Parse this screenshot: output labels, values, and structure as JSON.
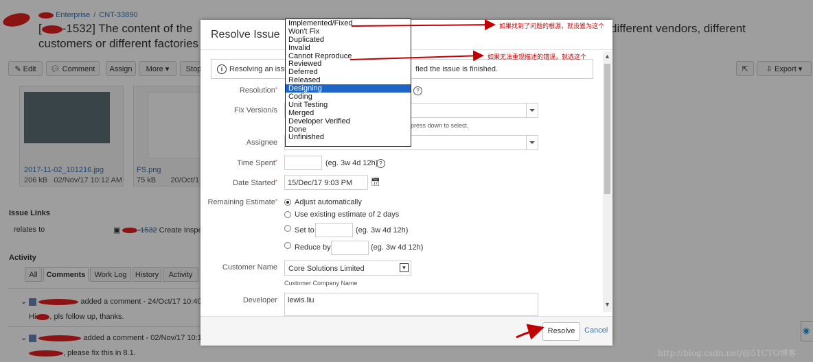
{
  "background": {
    "breadcrumb": {
      "project": "Enterprise",
      "issue_key": "CNT-33890"
    },
    "issue_title": {
      "left": "-1532] The content of the",
      "left_prefix": "[",
      "right": "different vendors, different",
      "line2": "customers or different factories"
    },
    "toolbar": {
      "edit": "Edit",
      "comment": "Comment",
      "assign": "Assign",
      "more": "More",
      "stop": "Stop",
      "export": "Export"
    },
    "attachments": [
      {
        "name": "2017-11-02_101216.jpg",
        "size": "206 kB",
        "date": "02/Nov/17 10:12 AM"
      },
      {
        "name": "FS.png",
        "size": "75 kB",
        "date": "20/Oct/1"
      }
    ],
    "issue_links": {
      "heading": "Issue Links",
      "relation": "relates to",
      "linked_key": "-1532",
      "linked_summary": "Create Inspe"
    },
    "activity": {
      "heading": "Activity",
      "tabs": [
        "All",
        "Comments",
        "Work Log",
        "History",
        "Activity"
      ],
      "active_tab": "Comments",
      "comments": [
        {
          "meta": "added a comment - 24/Oct/17 10:40 A",
          "body": "Hi",
          "body_rest": ", pls follow up, thanks."
        },
        {
          "meta": "added a comment - 02/Nov/17 10:13",
          "body_rest": ", please fix this in 8.1."
        }
      ]
    }
  },
  "dialog": {
    "title": "Resolve Issue",
    "info_text": "Resolving an issu",
    "info_text_tail": "fied the issue is finished.",
    "resolution_label": "Resolution",
    "fix_version_label": "Fix Version/s",
    "fix_version_hint": "press down to select.",
    "assignee_label": "Assignee",
    "time_spent_label": "Time Spent",
    "time_spent_hint": "(eg. 3w 4d 12h)",
    "date_started_label": "Date Started",
    "date_started_value": "15/Dec/17 9:03 PM",
    "remaining_label": "Remaining Estimate",
    "remaining_options": [
      {
        "label": "Adjust automatically",
        "selected": true
      },
      {
        "label": "Use existing estimate of 2 days",
        "selected": false
      },
      {
        "label": "Set to",
        "selected": false,
        "hint": "(eg. 3w 4d 12h)"
      },
      {
        "label": "Reduce by",
        "selected": false,
        "hint": "(eg. 3w 4d 12h)"
      }
    ],
    "customer_name_label": "Customer Name",
    "customer_name_value": "Core Solutions Limited",
    "customer_hint": "Customer Company Name",
    "developer_label": "Developer",
    "developer_value": "lewis.liu",
    "resolve_button": "Resolve",
    "cancel_link": "Cancel"
  },
  "resolution_dropdown": {
    "options": [
      "Implemented/Fixed",
      "Won't Fix",
      "Duplicated",
      "Invalid",
      "Cannot Reproduce",
      "Reviewed",
      "Deferred",
      "Released",
      "Designing",
      "Coding",
      "Unit Testing",
      "Merged",
      "Developer Verified",
      "Done",
      "Unfinished"
    ],
    "highlighted": "Designing"
  },
  "annotations": {
    "note_fixed": "如果找到了问题的根源，就设置为这个",
    "note_cannot_reproduce": "如果无法重现描述的错误，就选这个"
  },
  "watermark": "http://blog.csdn.net/@51CTO博客",
  "colors": {
    "link": "#3572b0",
    "highlight": "#1e63c6",
    "annotation_red": "#c00000",
    "required": "#d04437"
  }
}
